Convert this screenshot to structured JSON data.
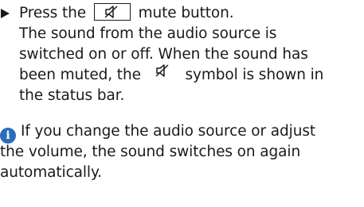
{
  "step": {
    "prefix": "Press the",
    "suffix": "mute button.",
    "icon": "mute-speaker-icon"
  },
  "result": {
    "line1": "The sound from the audio source is",
    "line2": "switched on or off. When the sound has",
    "line3_before": "been muted, the",
    "line3_after": "symbol is shown in",
    "line4": "the status bar."
  },
  "note": {
    "line1": "If you change the audio source or adjust",
    "line2": "the volume, the sound switches on again",
    "line3": "automatically.",
    "icon": "info-icon",
    "icon_color": "#2b6cb8"
  }
}
